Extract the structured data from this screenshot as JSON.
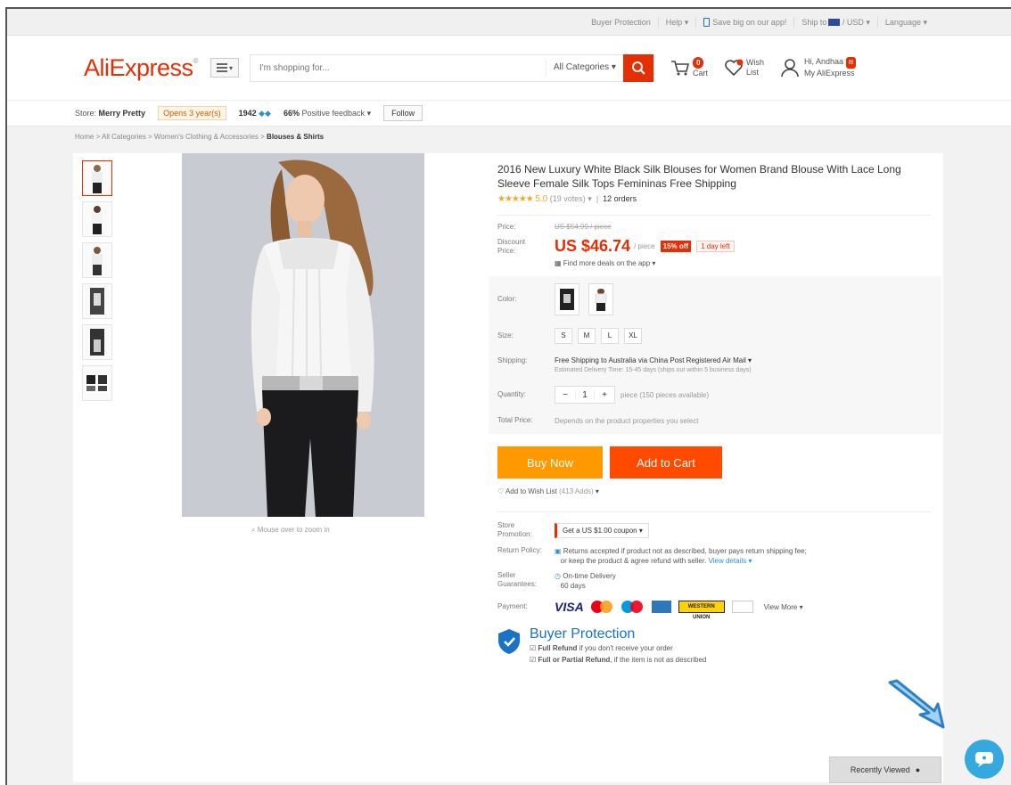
{
  "topbar": {
    "buyer_protection": "Buyer Protection",
    "help": "Help",
    "app": "Save big on our app!",
    "ship_to": "Ship to",
    "currency": "USD",
    "language": "Language"
  },
  "header": {
    "logo": "AliExpress",
    "search_placeholder": "I'm shopping for...",
    "categories": "All Categories",
    "cart_count": "0",
    "cart_label": "Cart",
    "wish_label_1": "Wish",
    "wish_label_2": "List",
    "user_greeting": "Hi, Andhaa",
    "user_account": "My AliExpress"
  },
  "store": {
    "store_label": "Store:",
    "store_name": "Merry Pretty",
    "opens": "Opens 3 year(s)",
    "rating_count": "1942",
    "positive": "66%",
    "positive_label": "Positive feedback",
    "follow": "Follow"
  },
  "breadcrumb": {
    "trail": "Home > All Categories > Women's Clothing & Accessories > ",
    "current": "Blouses & Shirts"
  },
  "gallery": {
    "zoom_hint": "Mouse over to zoom in"
  },
  "product": {
    "title": "2016 New Luxury White Black Silk Blouses for Women Brand Blouse With Lace Long Sleeve Female Silk Tops Femininas Free Shipping",
    "stars": "★★★★★",
    "score": "5.0",
    "votes": "(19 votes)",
    "orders": "12 orders",
    "price_label": "Price:",
    "old_price": "US $54.99 / piece",
    "discount_label_1": "Discount",
    "discount_label_2": "Price:",
    "price": "US $46.74",
    "per_piece": "/ piece",
    "off": "15% off",
    "day_left": "1 day left",
    "app_deals": "Find more deals on the app"
  },
  "options": {
    "color_label": "Color:",
    "size_label": "Size:",
    "sizes": [
      "S",
      "M",
      "L",
      "XL"
    ],
    "shipping_label": "Shipping:",
    "shipping_text": "Free Shipping to Australia via China Post Registered Air Mail",
    "delivery_text": "Estimated Delivery Time: 15-45 days (ships out within 5 business days)",
    "quantity_label": "Quantity:",
    "qty_minus": "−",
    "qty_value": "1",
    "qty_plus": "+",
    "qty_available": "piece (150 pieces available)",
    "total_label": "Total Price:",
    "total_text": "Depends on the product properties you select"
  },
  "actions": {
    "buy_now": "Buy Now",
    "add_to_cart": "Add to Cart",
    "wish": "Add to Wish List",
    "wish_count": "(413 Adds)"
  },
  "store_promo": {
    "label_1": "Store",
    "label_2": "Promotion:",
    "coupon": "Get a US $1.00 coupon"
  },
  "return_policy": {
    "label": "Return Policy:",
    "text_1": "Returns accepted if product not as described, buyer pays return shipping fee;",
    "text_2": "or keep the product & agree refund with seller.",
    "details": "View details"
  },
  "guarantee": {
    "label_1": "Seller",
    "label_2": "Guarantees:",
    "text": "On-time Delivery",
    "days": "60 days"
  },
  "payment": {
    "label": "Payment:",
    "visa": "VISA",
    "wu": "WESTERN UNION",
    "view_more": "View More"
  },
  "buyer_protection": {
    "title": "Buyer Protection",
    "line1_b": "Full Refund",
    "line1": " if you don't receive your order",
    "line2_b": "Full or Partial Refund",
    "line2": ", if the item is not as described"
  },
  "floating": {
    "recently_viewed": "Recently Viewed"
  }
}
